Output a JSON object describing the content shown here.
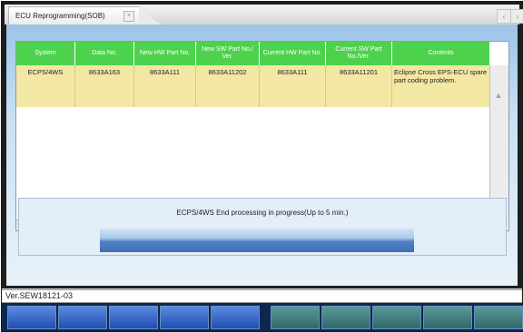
{
  "window": {
    "tab_title": "ECU Reprogramming(SOB)",
    "nav_prev_icon": "chevron-left-icon",
    "nav_next_icon": "chevron-right-icon"
  },
  "table": {
    "columns": [
      "System",
      "Data No.",
      "New HW Part No.",
      "New SW Part No./ Ver.",
      "Current HW Part No.",
      "Current SW Part No./Ver.",
      "Contents"
    ],
    "rows": [
      [
        "ECPS/4WS",
        "8633A163",
        "8633A111",
        "8633A11202",
        "8633A111",
        "8633A11201",
        "Eclipse Cross    EPS-ECU spare part coding problem."
      ]
    ],
    "header_color": "#4ed24e",
    "row_color": "#f3e7a4"
  },
  "progress": {
    "message": "ECPS/4WS End processing in progress(Up to 5 min.)",
    "fraction": 1.0
  },
  "status": {
    "version": "Ver.SEW18121-03"
  },
  "function_keys": {
    "count": 10,
    "colors": [
      "blue",
      "blue",
      "blue",
      "blue",
      "blue",
      "teal",
      "teal",
      "teal",
      "teal",
      "teal"
    ]
  }
}
